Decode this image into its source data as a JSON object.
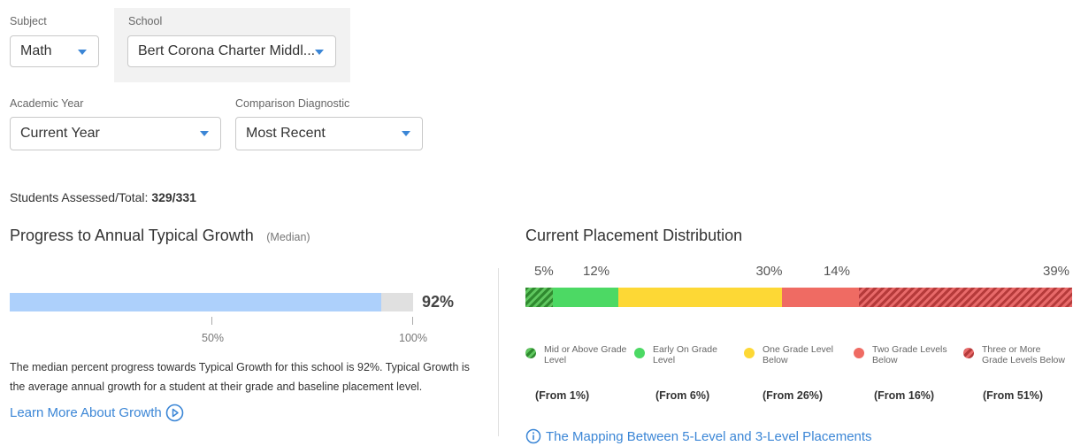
{
  "filters": {
    "subject": {
      "label": "Subject",
      "value": "Math"
    },
    "school": {
      "label": "School",
      "value": "Bert Corona Charter Middl..."
    },
    "academic_year": {
      "label": "Academic Year",
      "value": "Current Year"
    },
    "comparison": {
      "label": "Comparison Diagnostic",
      "value": "Most Recent"
    }
  },
  "students": {
    "label": "Students Assessed/Total:",
    "value": "329/331"
  },
  "progress": {
    "title": "Progress to Annual Typical Growth",
    "subtitle": "(Median)",
    "value_label": "92%",
    "value_percent": 92,
    "ticks": [
      "50%",
      "100%"
    ],
    "description": "The median percent progress towards Typical Growth for this school is 92%. Typical Growth is the average annual growth for a student at their grade and baseline placement level.",
    "learn_more": "Learn More About Growth",
    "colors": {
      "fill": "#add0fb",
      "track": "#e0e0e0"
    }
  },
  "placement": {
    "title": "Current Placement Distribution",
    "mapping_link": "The Mapping Between 5-Level and 3-Level Placements",
    "segments": [
      {
        "pct_label": "5%",
        "value": 5,
        "name": "Mid or Above Grade Level",
        "from": "(From 1%)",
        "color": "#4cc24c",
        "style": "hatch-green"
      },
      {
        "pct_label": "12%",
        "value": 12,
        "name": "Early On Grade Level",
        "from": "(From 6%)",
        "color": "#4cd964",
        "style": "solid"
      },
      {
        "pct_label": "30%",
        "value": 30,
        "name": "One Grade Level Below",
        "from": "(From 26%)",
        "color": "#fdd835",
        "style": "solid"
      },
      {
        "pct_label": "14%",
        "value": 14,
        "name": "Two Grade Levels Below",
        "from": "(From 16%)",
        "color": "#ef6b63",
        "style": "solid"
      },
      {
        "pct_label": "39%",
        "value": 39,
        "name": "Three or More Grade Levels Below",
        "from": "(From 51%)",
        "color": "#e05a55",
        "style": "hatch-red"
      }
    ]
  }
}
